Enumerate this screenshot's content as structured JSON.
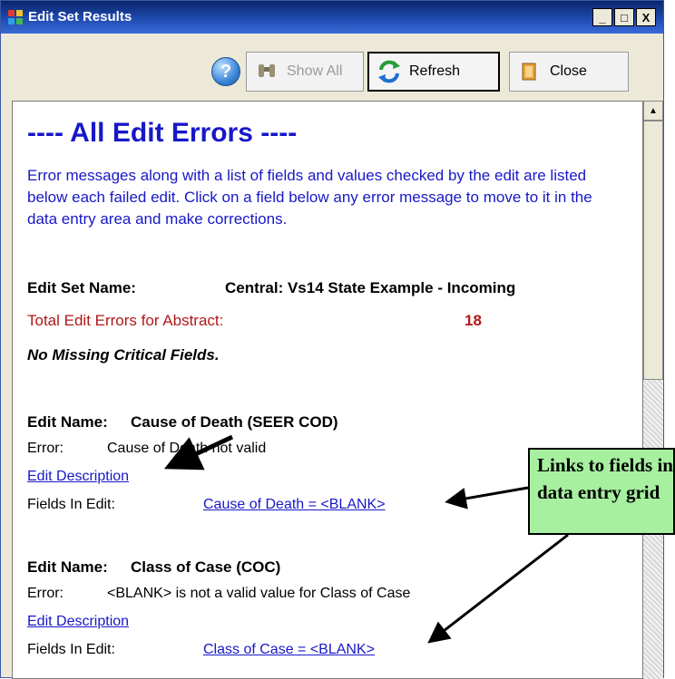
{
  "window": {
    "title": "Edit Set Results",
    "controls": [
      "_",
      "□",
      "X"
    ]
  },
  "toolbar": {
    "help_label": "?",
    "show_all_label": "Show All",
    "refresh_label": "Refresh",
    "close_label": "Close"
  },
  "content": {
    "heading": "---- All Edit Errors ----",
    "intro": "Error messages along with a list of fields and values checked by the edit are listed below each failed edit.  Click on a field below any error message to move to it in the data entry area and make corrections.",
    "edit_set_label": "Edit Set Name:",
    "edit_set_value": "Central: Vs14 State Example - Incoming",
    "total_label": "Total Edit Errors for Abstract:",
    "total_value": "18",
    "missing_critical": "No Missing Critical Fields.",
    "edits": [
      {
        "name_label": "Edit Name:",
        "name": "Cause of Death (SEER COD)",
        "error_label": "Error:",
        "error": "Cause of Death not valid",
        "description_link": "Edit Description",
        "fields_label": "Fields In Edit:",
        "field_link": "Cause of Death = <BLANK>"
      },
      {
        "name_label": "Edit Name:",
        "name": "Class of Case (COC)",
        "error_label": "Error:",
        "error": "<BLANK> is not a valid value for Class of Case",
        "description_link": "Edit Description",
        "fields_label": "Fields In Edit:",
        "field_link": "Class of Case = <BLANK>"
      }
    ]
  },
  "callout": {
    "text": "Links to fields in data entry grid"
  },
  "colors": {
    "link": "#1818c8",
    "error_red": "#b01818",
    "callout_bg": "#a7f0a0",
    "titlebar": "#0a246a"
  },
  "icons": [
    "app-icon",
    "help-icon",
    "binoculars-icon",
    "refresh-icon",
    "close-book-icon",
    "scroll-up-icon"
  ]
}
